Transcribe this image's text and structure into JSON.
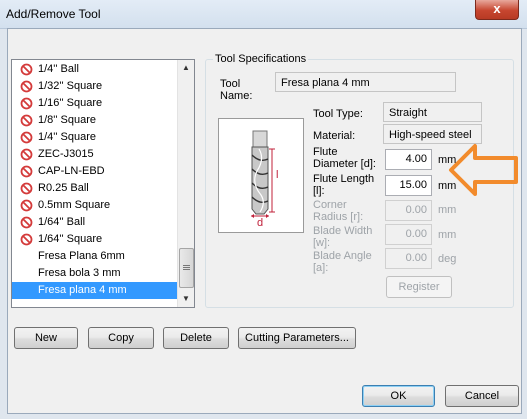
{
  "window": {
    "title": "Add/Remove Tool",
    "close_glyph": "x"
  },
  "tool_list": [
    {
      "name": "1/4'' Ball",
      "icon": "no-entry-icon"
    },
    {
      "name": "1/32'' Square",
      "icon": "no-entry-icon"
    },
    {
      "name": "1/16'' Square",
      "icon": "no-entry-icon"
    },
    {
      "name": "1/8'' Square",
      "icon": "no-entry-icon"
    },
    {
      "name": "1/4'' Square",
      "icon": "no-entry-icon"
    },
    {
      "name": "ZEC-J3015",
      "icon": "no-entry-icon"
    },
    {
      "name": "CAP-LN-EBD",
      "icon": "no-entry-icon"
    },
    {
      "name": "R0.25 Ball",
      "icon": "no-entry-icon"
    },
    {
      "name": "0.5mm Square",
      "icon": "no-entry-icon"
    },
    {
      "name": "1/64'' Ball",
      "icon": "no-entry-icon"
    },
    {
      "name": "1/64'' Square",
      "icon": "no-entry-icon"
    },
    {
      "name": "Fresa Plana 6mm",
      "icon": ""
    },
    {
      "name": "Fresa bola 3 mm",
      "icon": ""
    },
    {
      "name": "Fresa plana 4 mm",
      "icon": "",
      "selected": true
    }
  ],
  "spec": {
    "group_title": "Tool Specifications",
    "tool_name_label": "Tool Name:",
    "tool_name_value": "Fresa plana 4 mm",
    "tool_type_label": "Tool Type:",
    "tool_type_value": "Straight",
    "material_label": "Material:",
    "material_value": "High-speed steel",
    "flute_diameter_label": "Flute Diameter [d]:",
    "flute_diameter_value": "4.00",
    "flute_diameter_unit": "mm",
    "flute_length_label": "Flute Length [l]:",
    "flute_length_value": "15.00",
    "flute_length_unit": "mm",
    "corner_radius_label": "Corner Radius [r]:",
    "corner_radius_value": "0.00",
    "corner_radius_unit": "mm",
    "blade_width_label": "Blade Width [w]:",
    "blade_width_value": "0.00",
    "blade_width_unit": "mm",
    "blade_angle_label": "Blade Angle [a]:",
    "blade_angle_value": "0.00",
    "blade_angle_unit": "deg",
    "register_label": "Register",
    "diagram_length_label": "l",
    "diagram_diameter_label": "d"
  },
  "buttons": {
    "new": "New",
    "copy": "Copy",
    "delete": "Delete",
    "cutting": "Cutting Parameters...",
    "ok": "OK",
    "cancel": "Cancel"
  },
  "colors": {
    "selection": "#3399ff",
    "annotation_arrow": "#f28b2c",
    "no_entry": "#d43b3b",
    "dimension": "#c0203a"
  }
}
